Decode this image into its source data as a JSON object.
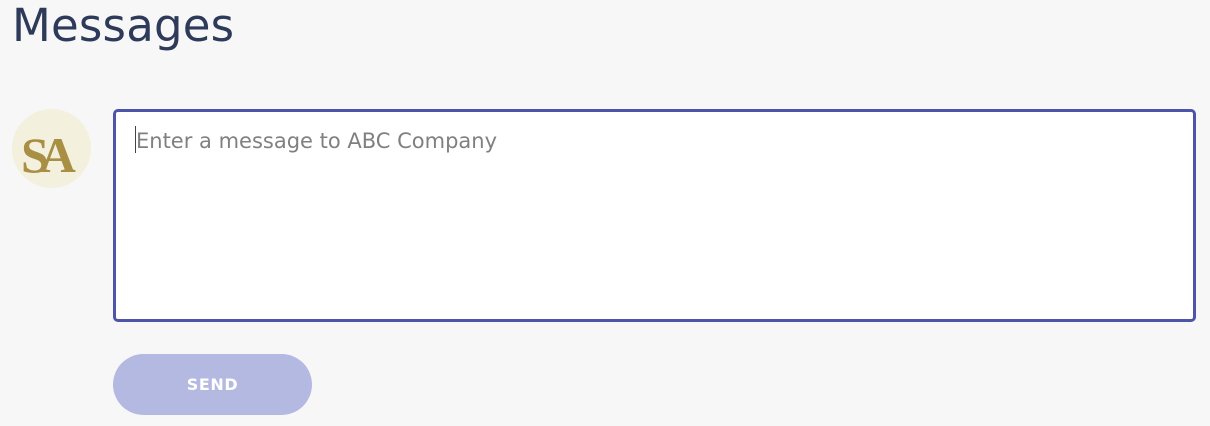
{
  "header": {
    "title": "Messages"
  },
  "avatar": {
    "initials": "SA",
    "background": "#f3f0de",
    "monogram_color": "#a98f44"
  },
  "composer": {
    "placeholder": "Enter a message to ABC Company",
    "value": "",
    "border_color": "#4c55aa"
  },
  "actions": {
    "send_label": "SEND",
    "send_background": "#b4b9e2",
    "send_disabled": true
  }
}
